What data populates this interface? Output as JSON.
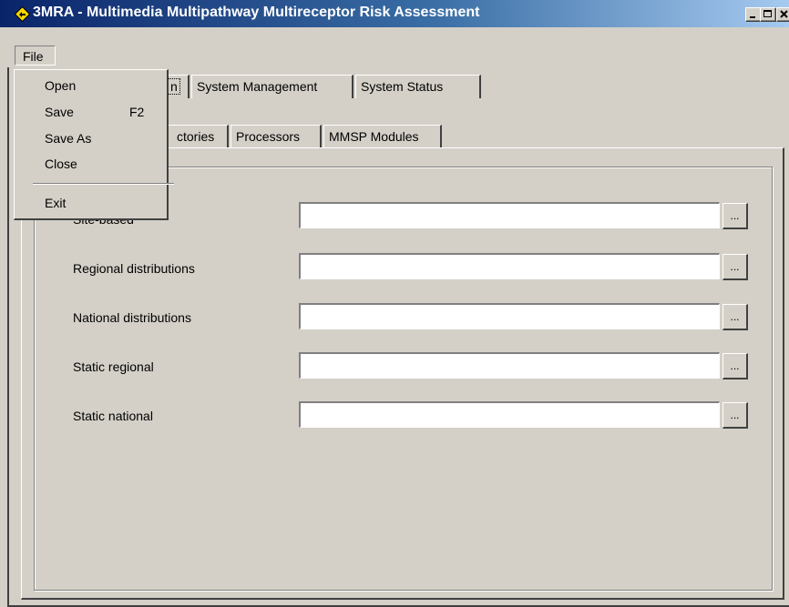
{
  "window": {
    "title": "3MRA - Multimedia Multipathway Multireceptor Risk Assessment",
    "icon": "diamond-warning-icon"
  },
  "menubar": {
    "file_label": "File"
  },
  "file_menu": {
    "items": [
      {
        "label": "Open",
        "shortcut": ""
      },
      {
        "label": "Save",
        "shortcut": "F2"
      },
      {
        "label": "Save As",
        "shortcut": ""
      },
      {
        "label": "Close",
        "shortcut": ""
      },
      {
        "label": "Exit",
        "shortcut": ""
      }
    ]
  },
  "top_tabs": [
    {
      "label": "n"
    },
    {
      "label": "System Management"
    },
    {
      "label": "System Status"
    }
  ],
  "sub_tabs": [
    {
      "label": "ctories"
    },
    {
      "label": "Processors"
    },
    {
      "label": "MMSP Modules"
    }
  ],
  "form": {
    "rows": [
      {
        "label": "Site-based",
        "value": "",
        "button": "..."
      },
      {
        "label": "Regional distributions",
        "value": "",
        "button": "..."
      },
      {
        "label": "National distributions",
        "value": "",
        "button": "..."
      },
      {
        "label": "Static regional",
        "value": "",
        "button": "..."
      },
      {
        "label": "Static national",
        "value": "",
        "button": "..."
      }
    ]
  },
  "colors": {
    "titlebar": "#0a246a",
    "face": "#d4d0c8",
    "icon_yellow": "#f8d800"
  }
}
